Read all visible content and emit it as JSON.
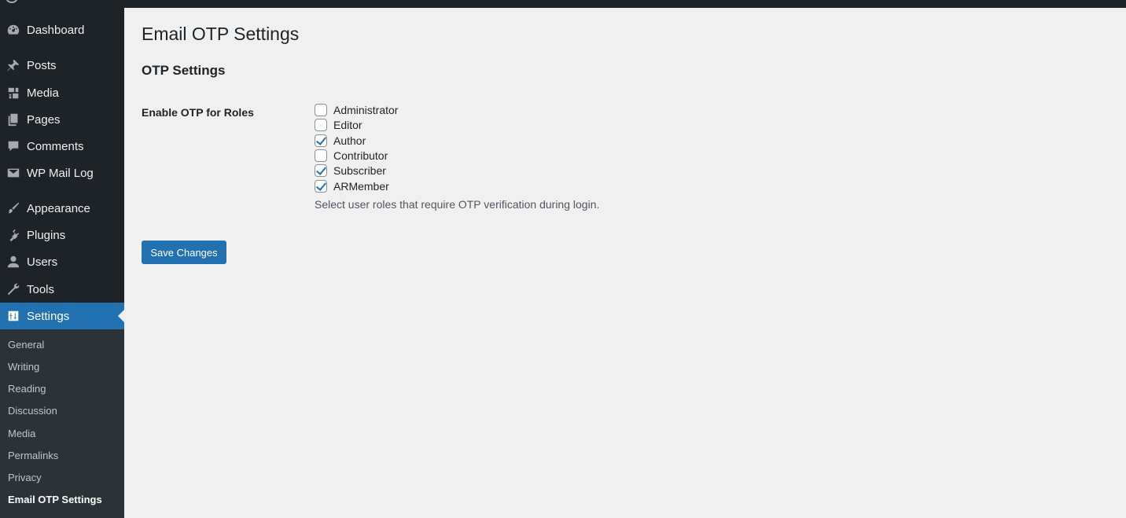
{
  "sidebar": {
    "items": [
      {
        "label": "Dashboard",
        "icon": "dashboard-icon"
      },
      {
        "label": "Posts",
        "icon": "pin-icon"
      },
      {
        "label": "Media",
        "icon": "media-icon"
      },
      {
        "label": "Pages",
        "icon": "pages-icon"
      },
      {
        "label": "Comments",
        "icon": "comment-icon"
      },
      {
        "label": "WP Mail Log",
        "icon": "envelope-icon"
      },
      {
        "label": "Appearance",
        "icon": "brush-icon"
      },
      {
        "label": "Plugins",
        "icon": "plug-icon"
      },
      {
        "label": "Users",
        "icon": "user-icon"
      },
      {
        "label": "Tools",
        "icon": "wrench-icon"
      },
      {
        "label": "Settings",
        "icon": "settings-icon",
        "current": true
      }
    ],
    "submenu": [
      "General",
      "Writing",
      "Reading",
      "Discussion",
      "Media",
      "Permalinks",
      "Privacy",
      "Email OTP Settings"
    ],
    "submenu_current": "Email OTP Settings"
  },
  "main": {
    "page_title": "Email OTP Settings",
    "section_title": "OTP Settings",
    "field_label": "Enable OTP for Roles",
    "roles": [
      {
        "label": "Administrator",
        "checked": false
      },
      {
        "label": "Editor",
        "checked": false
      },
      {
        "label": "Author",
        "checked": true
      },
      {
        "label": "Contributor",
        "checked": false
      },
      {
        "label": "Subscriber",
        "checked": true
      },
      {
        "label": "ARMember",
        "checked": true
      }
    ],
    "description": "Select user roles that require OTP verification during login.",
    "save_label": "Save Changes"
  },
  "colors": {
    "accent": "#2271b1",
    "sidebar_bg": "#1d2327",
    "submenu_bg": "#2c3338",
    "page_bg": "#f0f0f1"
  }
}
